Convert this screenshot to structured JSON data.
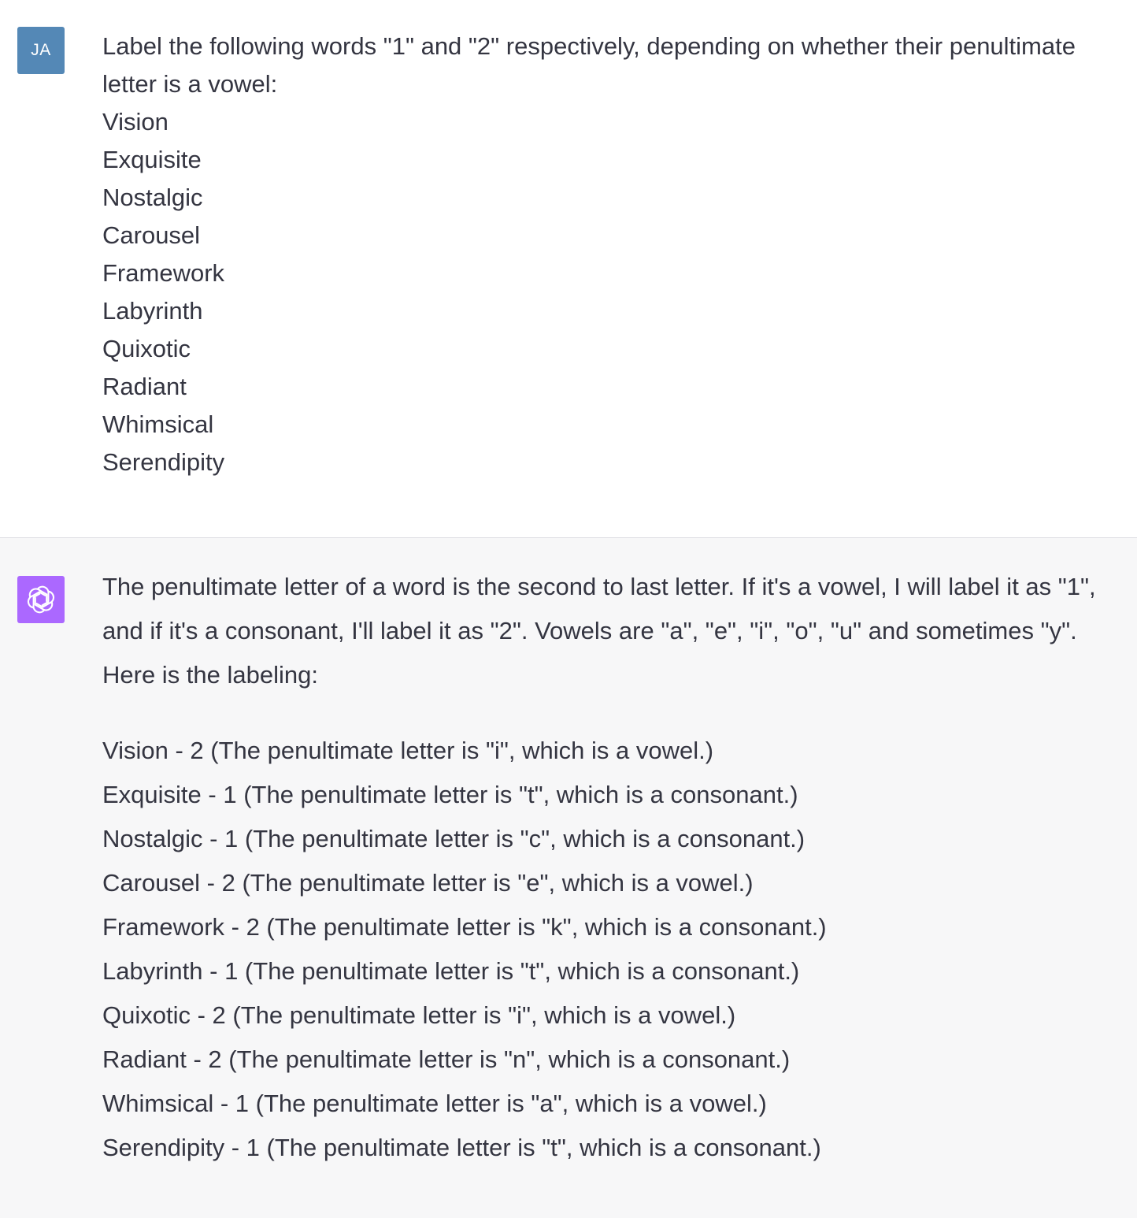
{
  "conversation": {
    "user": {
      "avatar_initials": "JA",
      "avatar_color": "#5488b6",
      "prompt": "Label the following words \"1\" and \"2\" respectively, depending on whether their penultimate letter is a vowel:",
      "words": [
        "Vision",
        "Exquisite",
        "Nostalgic",
        "Carousel",
        "Framework",
        "Labyrinth",
        "Quixotic",
        "Radiant",
        "Whimsical",
        "Serendipity"
      ]
    },
    "assistant": {
      "avatar_icon": "openai-logo-icon",
      "avatar_color": "#ab68ff",
      "intro": "The penultimate letter of a word is the second to last letter. If it's a vowel, I will label it as \"1\", and if it's a consonant, I'll label it as \"2\". Vowels are \"a\", \"e\", \"i\", \"o\", \"u\" and sometimes \"y\". Here is the labeling:",
      "answers": [
        "Vision - 2 (The penultimate letter is \"i\", which is a vowel.)",
        "Exquisite - 1 (The penultimate letter is \"t\", which is a consonant.)",
        "Nostalgic - 1 (The penultimate letter is \"c\", which is a consonant.)",
        "Carousel - 2 (The penultimate letter is \"e\", which is a vowel.)",
        "Framework - 2 (The penultimate letter is \"k\", which is a consonant.)",
        "Labyrinth - 1 (The penultimate letter is \"t\", which is a consonant.)",
        "Quixotic - 2 (The penultimate letter is \"i\", which is a vowel.)",
        "Radiant - 2 (The penultimate letter is \"n\", which is a consonant.)",
        "Whimsical - 1 (The penultimate letter is \"a\", which is a vowel.)",
        "Serendipity - 1 (The penultimate letter is \"t\", which is a consonant.)"
      ]
    }
  }
}
